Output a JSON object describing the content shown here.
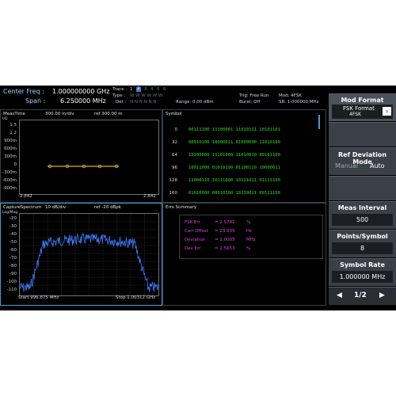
{
  "header": {
    "center_freq_label": "Center Freq :",
    "center_freq_value": "1.000000000 GHz",
    "span_label": "Span :",
    "span_value": "6.250000 MHz",
    "trace_label": "Trace :",
    "trace_numbers": [
      "1",
      "2",
      "3",
      "4",
      "5",
      "6"
    ],
    "type_label": "Type :",
    "type_values": "W W W W W W",
    "det_label": "Det :",
    "det_values": "N N N N N N",
    "range": "Range: 0.00 dBm",
    "trig": "Trig: Free Run",
    "burst": "Burst: Off",
    "mod": "Mod: 4FSK",
    "sr": "SR: 1.000000 MHz"
  },
  "meastime": {
    "title": "MeasTime",
    "div": "300.00 m/div",
    "ref": "ref 300.00 m",
    "y_unit": "I/Q",
    "y_labels": [
      "1.5",
      "1.2",
      "900m",
      "600m",
      "300m",
      "0",
      "-300m",
      "-600m",
      "-900m"
    ],
    "x_start": "-2.842",
    "x_end": "2.842"
  },
  "symbol": {
    "title": "Symbol",
    "indices": [
      "0",
      "32",
      "64",
      "96",
      "128",
      "160"
    ],
    "rows": [
      "00111100  11100001  11010111  10101101",
      "00010100  10000011  01000000  11010100",
      "10100000  11101000  11010010  00101100",
      "10011000  01010100  01100110  10000011",
      "11000110  10111000  10111011  01111100",
      "01010000  00010100  10110011  00111100"
    ]
  },
  "capture": {
    "title": "CaptureSpectrum",
    "div": "10 dB/div",
    "ref": "ref -20 dBpk",
    "y_unit": "Log/Mag",
    "y_labels": [
      "-20",
      "-30",
      "-40",
      "-50",
      "-60",
      "-70",
      "-80",
      "-90",
      "-100",
      "-110"
    ],
    "start": "Start 996.875 MHz",
    "stop": "Stop 1.00312 GHz"
  },
  "errs": {
    "title": "Errs Summary",
    "rows": [
      {
        "name": "FSK Err",
        "value": "= 2.5781",
        "unit": "%"
      },
      {
        "name": "Carr Offset",
        "value": "= 23.935",
        "unit": "Hz"
      },
      {
        "name": "Deviation",
        "value": "= 1.0005",
        "unit": "MHz"
      },
      {
        "name": "Dev Err",
        "value": "= 2.5653",
        "unit": "%"
      }
    ]
  },
  "softkeys": {
    "mod_format_title": "Mod Format",
    "fsk_format_label": "FSK Format",
    "fsk_format_value": "4FSK",
    "ref_dev_title": "Ref Deviation Mode",
    "ref_dev_manual": "Manual",
    "ref_dev_auto": "Auto",
    "meas_interval_title": "Meas Interval",
    "meas_interval_value": "500",
    "points_per_symbol_title": "Points/Symbol",
    "points_per_symbol_value": "8",
    "symbol_rate_title": "Symbol Rate",
    "symbol_rate_value": "1.000000 MHz",
    "page": "1/2"
  },
  "colors": {
    "trace_blue": "#3a7dff",
    "symbol_green": "#28e028",
    "errs_magenta": "#e040e0",
    "eye_orange": "#c88a1e",
    "active_border": "#3d9bd8"
  }
}
